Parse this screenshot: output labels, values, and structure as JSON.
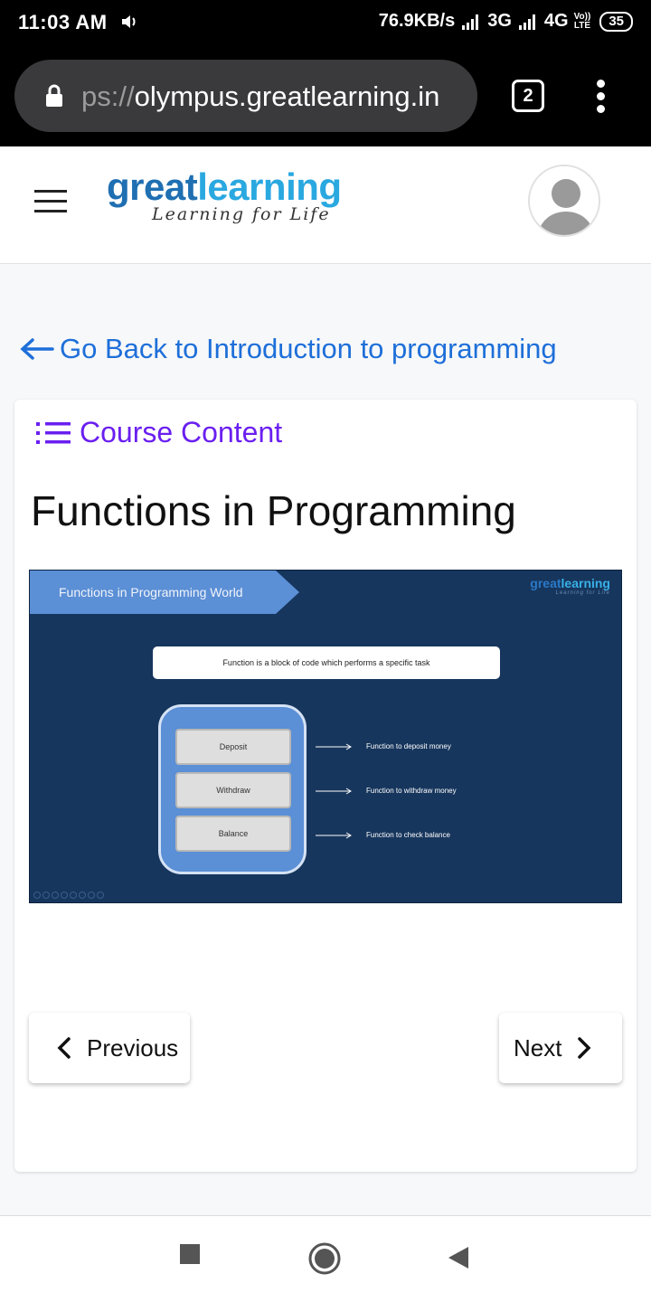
{
  "status_bar": {
    "time": "11:03 AM",
    "net_speed": "76.9KB/s",
    "net_3g": "3G",
    "net_4g": "4G",
    "volte_top": "Vo))",
    "volte_bottom": "LTE",
    "battery": "35"
  },
  "browser": {
    "url_prefix": "ps://",
    "url_host": "olympus.greatlearning.in",
    "tab_count": "2"
  },
  "header": {
    "logo_great": "great",
    "logo_learning": "learning",
    "logo_tagline": "Learning for Life"
  },
  "back_link": "Go Back to Introduction to programming",
  "card": {
    "course_content_label": "Course Content",
    "title": "Functions in Programming",
    "slide": {
      "banner": "Functions in Programming World",
      "logo_great": "great",
      "logo_learning": "learning",
      "logo_tagline": "Learning for Life",
      "definition": "Function is a block of code which performs a specific task",
      "items": [
        {
          "label": "Deposit",
          "description": "Function to deposit money"
        },
        {
          "label": "Withdraw",
          "description": "Function to withdraw money"
        },
        {
          "label": "Balance",
          "description": "Function to check balance"
        }
      ]
    },
    "previous_label": "Previous",
    "next_label": "Next"
  },
  "colors": {
    "link_blue": "#1e6fd9",
    "course_purple": "#6a1ff0",
    "slide_bg": "#17365d",
    "slide_accent": "#5b8fd6"
  }
}
